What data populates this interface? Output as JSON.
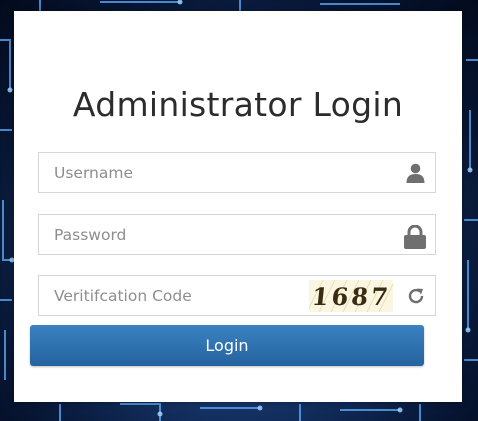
{
  "page": {
    "title": "Administrator Login"
  },
  "form": {
    "username": {
      "placeholder": "Username",
      "value": ""
    },
    "password": {
      "placeholder": "Password",
      "value": ""
    },
    "verification": {
      "placeholder": "Veritifcation Code",
      "value": "",
      "captcha_text": "1687"
    },
    "login_label": "Login"
  },
  "icons": {
    "username": "user-icon",
    "password": "lock-icon",
    "captcha_refresh": "refresh-icon"
  },
  "colors": {
    "button": "#2e70ae",
    "background": "#0b2456",
    "icon": "#6f6f6f"
  }
}
